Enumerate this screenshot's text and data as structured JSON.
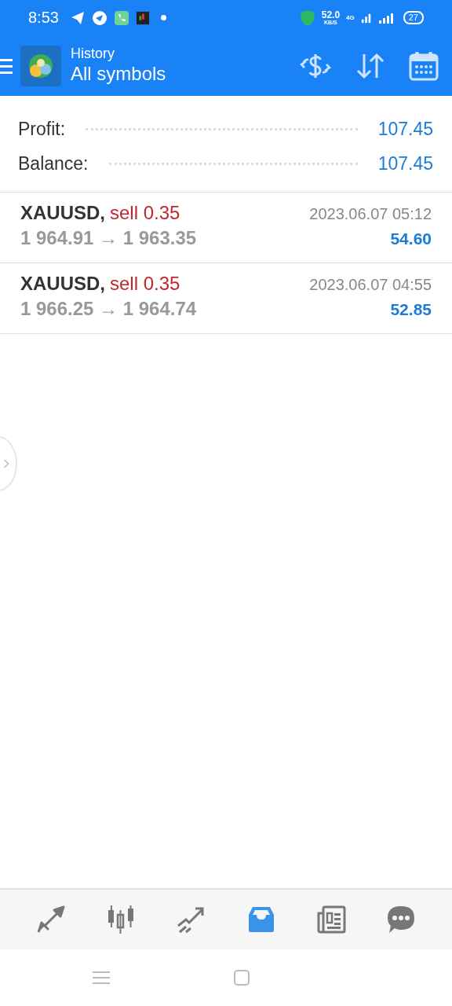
{
  "status_bar": {
    "time": "8:53",
    "speed": "52.0",
    "speed_unit": "KB/S",
    "network": "4G",
    "battery": "27"
  },
  "header": {
    "title": "History",
    "subtitle": "All symbols"
  },
  "summary": [
    {
      "label": "Profit:",
      "value": "107.45"
    },
    {
      "label": "Balance:",
      "value": "107.45"
    }
  ],
  "trades": [
    {
      "symbol": "XAUUSD,",
      "action": "sell 0.35",
      "prices": "1 964.91 → 1 963.35",
      "time": "2023.06.07 05:12",
      "profit": "54.60"
    },
    {
      "symbol": "XAUUSD,",
      "action": "sell 0.35",
      "prices": "1 966.25 → 1 964.74",
      "time": "2023.06.07 04:55",
      "profit": "52.85"
    }
  ],
  "bottom_nav": [
    {
      "kind": "quotes",
      "selected": false
    },
    {
      "kind": "chart",
      "selected": false
    },
    {
      "kind": "trade",
      "selected": false
    },
    {
      "kind": "history",
      "selected": true
    },
    {
      "kind": "news",
      "selected": false
    },
    {
      "kind": "chat",
      "selected": false
    }
  ]
}
